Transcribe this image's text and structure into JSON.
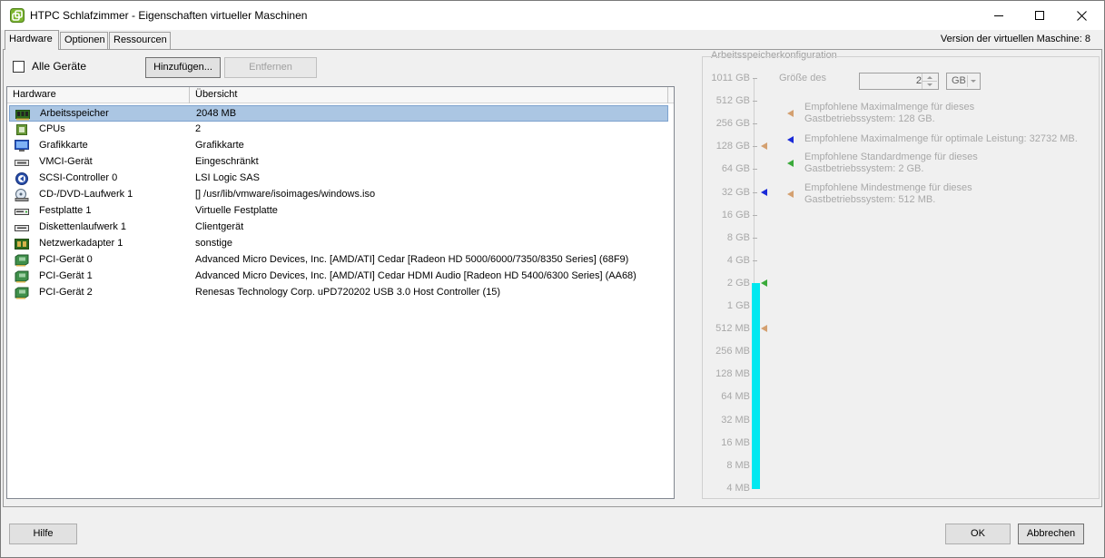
{
  "window": {
    "title": "HTPC Schlafzimmer - Eigenschaften virtueller Maschinen"
  },
  "tabs": [
    {
      "label": "Hardware",
      "active": true
    },
    {
      "label": "Optionen",
      "active": false
    },
    {
      "label": "Ressourcen",
      "active": false
    }
  ],
  "version": "Version der virtuellen Maschine: 8",
  "toolbar": {
    "all_devices_label": "Alle Geräte",
    "all_devices_checked": false,
    "add_label": "Hinzufügen...",
    "remove_label": "Entfernen"
  },
  "hardware_list": {
    "columns": [
      "Hardware",
      "Übersicht"
    ],
    "rows": [
      {
        "name": "Arbeitsspeicher",
        "summary": "2048 MB",
        "icon": "memory-icon",
        "selected": true
      },
      {
        "name": "CPUs",
        "summary": "2",
        "icon": "cpu-icon"
      },
      {
        "name": "Grafikkarte",
        "summary": "Grafikkarte",
        "icon": "monitor-icon"
      },
      {
        "name": "VMCI-Gerät",
        "summary": "Eingeschränkt",
        "icon": "vmci-icon"
      },
      {
        "name": "SCSI-Controller 0",
        "summary": "LSI Logic SAS",
        "icon": "scsi-icon"
      },
      {
        "name": "CD-/DVD-Laufwerk 1",
        "summary": "[] /usr/lib/vmware/isoimages/windows.iso",
        "icon": "cdrom-icon"
      },
      {
        "name": "Festplatte 1",
        "summary": "Virtuelle Festplatte",
        "icon": "harddisk-icon"
      },
      {
        "name": "Diskettenlaufwerk 1",
        "summary": "Clientgerät",
        "icon": "floppy-icon"
      },
      {
        "name": "Netzwerkadapter 1",
        "summary": "sonstige",
        "icon": "network-icon"
      },
      {
        "name": "PCI-Gerät 0",
        "summary": "Advanced Micro Devices, Inc. [AMD/ATI] Cedar [Radeon HD 5000/6000/7350/8350 Series] (68F9)",
        "icon": "pci-icon"
      },
      {
        "name": "PCI-Gerät 1",
        "summary": "Advanced Micro Devices, Inc. [AMD/ATI] Cedar HDMI Audio [Radeon HD 5400/6300 Series] (AA68)",
        "icon": "pci-icon"
      },
      {
        "name": "PCI-Gerät 2",
        "summary": "Renesas Technology Corp. uPD720202 USB 3.0 Host Controller (15)",
        "icon": "pci-icon"
      }
    ]
  },
  "memory": {
    "group_title": "Arbeitsspeicherkonfiguration",
    "size_label": "Größe des",
    "size_value": "2",
    "unit": "GB",
    "scale_labels": [
      "1011 GB",
      "512 GB",
      "256 GB",
      "128 GB",
      "64 GB",
      "32 GB",
      "16 GB",
      "8 GB",
      "4 GB",
      "2 GB",
      "1 GB",
      "512 MB",
      "256 MB",
      "128 MB",
      "64 MB",
      "32 MB",
      "16 MB",
      "8 MB",
      "4 MB"
    ],
    "current_level_label": "2 GB",
    "legend": [
      {
        "line1": "Empfohlene Maximalmenge für dieses",
        "line2": "Gastbetriebssystem: 128 GB.",
        "color": "#d4a070"
      },
      {
        "line1": "Empfohlene Maximalmenge für optimale Leistung: 32732 MB.",
        "line2": "",
        "color": "#1a2ad8"
      },
      {
        "line1": "Empfohlene Standardmenge für dieses",
        "line2": "Gastbetriebssystem: 2 GB.",
        "color": "#3aaa3a"
      },
      {
        "line1": "Empfohlene Mindestmenge für dieses",
        "line2": "Gastbetriebssystem: 512 MB.",
        "color": "#d4a070"
      }
    ]
  },
  "footer": {
    "help_label": "Hilfe",
    "ok_label": "OK",
    "cancel_label": "Abbrechen"
  }
}
